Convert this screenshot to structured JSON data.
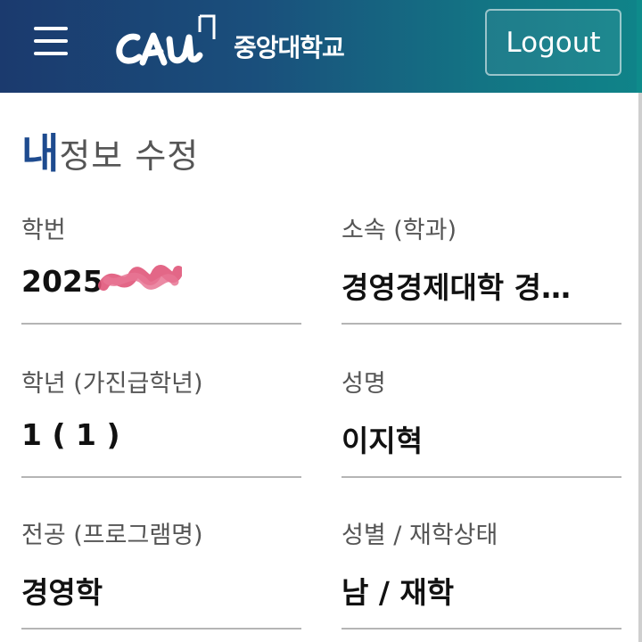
{
  "header": {
    "logo_wordmark": "CAU",
    "logo_text": "중앙대학교",
    "logout_label": "Logout"
  },
  "page": {
    "title_accent": "내",
    "title_rest": "정보 수정"
  },
  "fields": [
    {
      "label": "학번",
      "value": "2025"
    },
    {
      "label": "소속 (학과)",
      "value": "경영경제대학  경…"
    },
    {
      "label": "학년 (가진급학년)",
      "value": "1 ( 1 )"
    },
    {
      "label": "성명",
      "value": "이지혁"
    },
    {
      "label": "전공 (프로그램명)",
      "value": "경영학"
    },
    {
      "label": "성별 / 재학상태",
      "value": "남 / 재학"
    }
  ],
  "colors": {
    "header_start": "#1b3a6e",
    "header_end": "#0f8489",
    "accent": "#1e4b8f",
    "redaction": "#e0577a"
  }
}
